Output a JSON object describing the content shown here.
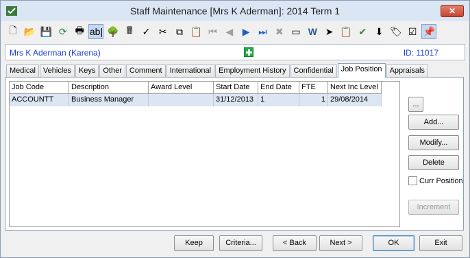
{
  "window": {
    "title": "Staff Maintenance  [Mrs K Aderman]:  2014 Term 1",
    "close_label": "✕"
  },
  "toolbar": {
    "icons": [
      {
        "name": "new-icon",
        "glyph": "🗋",
        "disabled": false
      },
      {
        "name": "open-folder-icon",
        "glyph": "📂",
        "disabled": false
      },
      {
        "name": "save-icon",
        "glyph": "💾",
        "disabled": true
      },
      {
        "name": "refresh-icon",
        "glyph": "⟳",
        "disabled": false
      },
      {
        "name": "print-icon",
        "glyph": "🖶",
        "disabled": false
      },
      {
        "name": "text-field-icon",
        "glyph": "ab|",
        "disabled": false,
        "active": true
      },
      {
        "name": "tree-icon",
        "glyph": "🌳",
        "disabled": false
      },
      {
        "name": "calculator-icon",
        "glyph": "🖩",
        "disabled": false
      },
      {
        "name": "spellcheck-icon",
        "glyph": "✓",
        "disabled": false
      },
      {
        "name": "cut-icon",
        "glyph": "✂",
        "disabled": false
      },
      {
        "name": "copy-icon",
        "glyph": "⧉",
        "disabled": false
      },
      {
        "name": "paste-icon",
        "glyph": "📋",
        "disabled": false
      },
      {
        "name": "first-record-icon",
        "glyph": "⏮",
        "disabled": true
      },
      {
        "name": "previous-record-icon",
        "glyph": "◀",
        "disabled": true
      },
      {
        "name": "next-record-icon",
        "glyph": "▶",
        "disabled": false
      },
      {
        "name": "last-record-icon",
        "glyph": "⏭",
        "disabled": false
      },
      {
        "name": "delete-icon",
        "glyph": "✖",
        "disabled": true
      },
      {
        "name": "card-icon",
        "glyph": "▭",
        "disabled": false
      },
      {
        "name": "word-document-icon",
        "glyph": "W",
        "disabled": false
      },
      {
        "name": "export-arrow-icon",
        "glyph": "➤",
        "disabled": false
      },
      {
        "name": "clipboard-edit-icon",
        "glyph": "📋",
        "disabled": false
      },
      {
        "name": "approve-icon",
        "glyph": "✔",
        "disabled": false
      },
      {
        "name": "download-icon",
        "glyph": "⬇",
        "disabled": false
      },
      {
        "name": "tag-icon",
        "glyph": "🏷",
        "disabled": false
      },
      {
        "name": "checklist-icon",
        "glyph": "☑",
        "disabled": false
      },
      {
        "name": "pin-icon",
        "glyph": "📌",
        "disabled": false,
        "active": true
      }
    ]
  },
  "staff": {
    "name": "Mrs K Aderman (Karena)",
    "id_label": "ID: 11017"
  },
  "tabs": [
    "Medical",
    "Vehicles",
    "Keys",
    "Other",
    "Comment",
    "International",
    "Employment History",
    "Confidential",
    "Job Position",
    "Appraisals"
  ],
  "selected_tab": "Job Position",
  "grid": {
    "columns": [
      "Job Code",
      "Description",
      "Award Level",
      "Start Date",
      "End Date",
      "FTE",
      "Next Inc Level"
    ],
    "rows": [
      [
        "ACCOUNTT",
        "Business Manager",
        "",
        "31/12/2013",
        "1",
        "1",
        "29/08/2014"
      ]
    ]
  },
  "side": {
    "ellipsis_label": "...",
    "add_label": "Add...",
    "modify_label": "Modify...",
    "delete_label": "Delete",
    "curr_position_label": "Curr Position",
    "increment_label": "Increment"
  },
  "footer": {
    "keep": "Keep",
    "criteria": "Criteria...",
    "back": "< Back",
    "next": "Next >",
    "ok": "OK",
    "exit": "Exit"
  }
}
